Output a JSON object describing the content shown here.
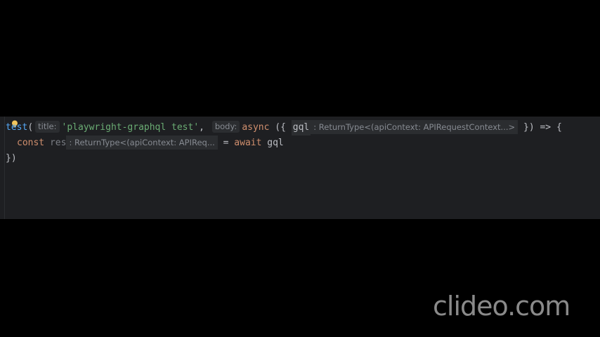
{
  "editor": {
    "line1": {
      "fn": "test",
      "open_paren": "(",
      "title_hint": "title:",
      "title_value": "'playwright-graphql test'",
      "comma": ",",
      "body_hint": "body:",
      "async_kw": "async",
      "destructure_open": "({",
      "param": "gql",
      "param_type_hint": ": ReturnType<(apiContext: APIRequestContext...>",
      "destructure_close": "}) => {"
    },
    "line2": {
      "const_kw": "const",
      "var_name": "res",
      "var_type_hint": ": ReturnType<(apiContext: APIReq...",
      "equals": "=",
      "await_kw": "await",
      "call": "gql"
    },
    "line3": {
      "close": "})"
    },
    "icons": {
      "intention": "lightbulb-icon"
    },
    "colors": {
      "background": "#1e1f22",
      "keyword": "#cf8e6d",
      "string": "#6aab73",
      "function": "#56a8f5",
      "hint": "#868a91",
      "lightbulb": "#f2c55c"
    }
  },
  "watermark": {
    "text": "clideo.com"
  }
}
